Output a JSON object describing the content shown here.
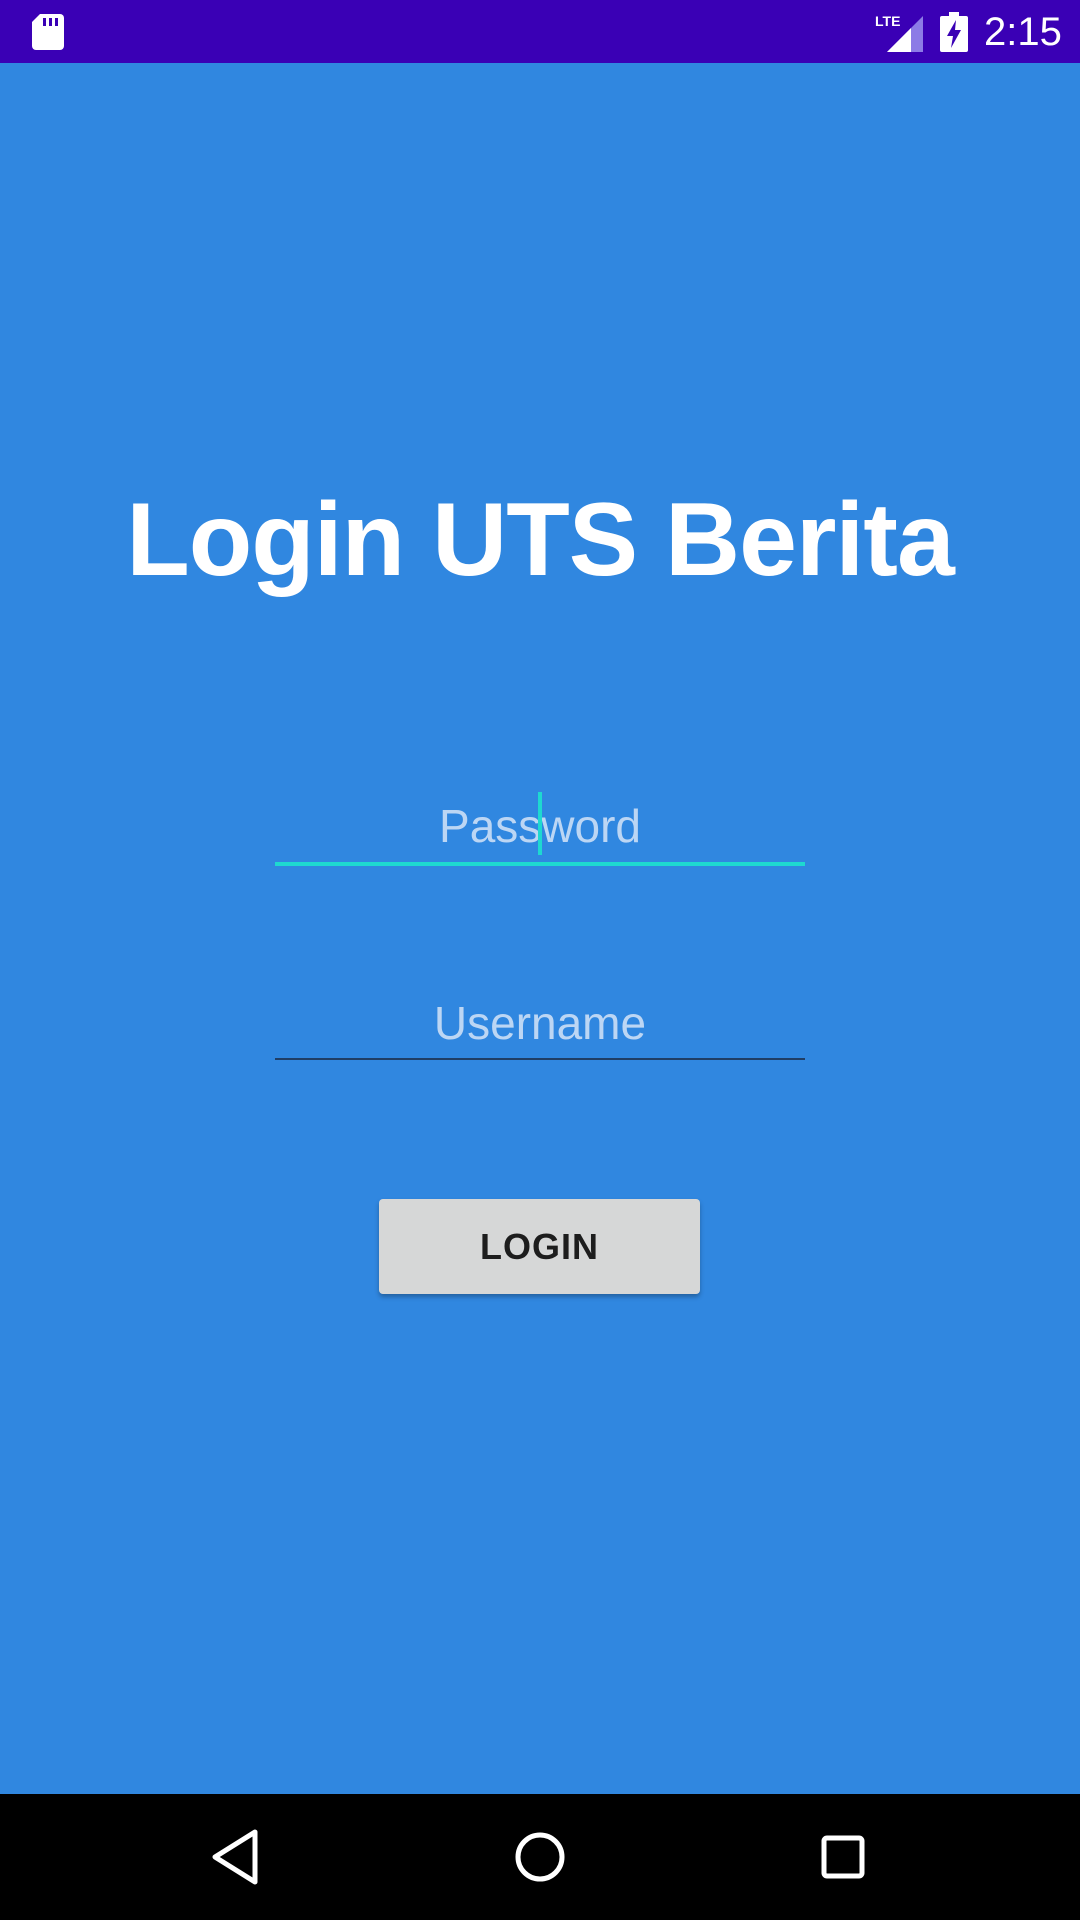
{
  "status_bar": {
    "time": "2:15",
    "network_label": "LTE",
    "icons": [
      "sd-card-icon",
      "lte-signal-icon",
      "battery-charging-icon"
    ]
  },
  "login": {
    "title": "Login UTS Berita",
    "password_placeholder": "Password",
    "username_placeholder": "Username",
    "login_label": "LOGIN"
  },
  "nav_bar": {
    "icons": [
      "back-icon",
      "home-icon",
      "recents-icon"
    ]
  },
  "colors": {
    "background": "#3087E0",
    "status_bar": "#3A00B5",
    "accent": "#1ED9D0",
    "button": "#D6D7D7"
  }
}
